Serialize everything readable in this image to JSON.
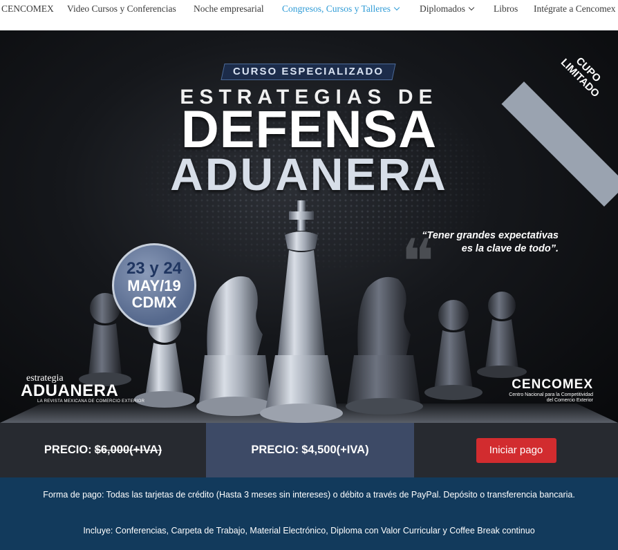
{
  "nav": {
    "items": [
      {
        "label": "CENCOMEX",
        "dropdown": false,
        "active": false
      },
      {
        "label": "Video Cursos y Conferencias",
        "dropdown": false,
        "active": false
      },
      {
        "label": "Noche empresarial",
        "dropdown": false,
        "active": false
      },
      {
        "label": "Congresos, Cursos y Talleres",
        "dropdown": true,
        "active": true
      },
      {
        "label": "Diplomados",
        "dropdown": true,
        "active": false
      },
      {
        "label": "Libros",
        "dropdown": false,
        "active": false
      },
      {
        "label": "Intégrate a Cencomex",
        "dropdown": false,
        "active": false
      }
    ],
    "active_color": "#2e9bd6"
  },
  "banner": {
    "kicker": "CURSO ESPECIALIZADO",
    "title_line1": "ESTRATEGIAS DE",
    "title_line2": "DEFENSA",
    "title_line3": "ADUANERA",
    "ribbon_line1": "CUPO",
    "ribbon_line2": "LIMITADO",
    "quote_line1": "“Tener grandes expectativas",
    "quote_line2": "es la clave de todo”.",
    "date_line1": "23 y 24",
    "date_line2": "MAY/19",
    "date_line3": "CDMX",
    "brand_left_top": "estrategia",
    "brand_left_main": "ADUANERA",
    "brand_left_sub": "LA REVISTA MEXICANA DE COMERCIO EXTERIOR",
    "brand_right_main": "CENCOMEX",
    "brand_right_sub1": "Centro Nacional para la Competitividad",
    "brand_right_sub2": "del Comercio Exterior"
  },
  "pricing": {
    "old_label": "PRECIO:",
    "old_price": "$6,000(+IVA)",
    "new_label": "PRECIO:",
    "new_price": "$4,500(+IVA)",
    "pay_button": "Iniciar pago",
    "button_color": "#d22c2f"
  },
  "info": {
    "payment": "Forma de pago: Todas las tarjetas de crédito (Hasta 3 meses sin intereses) o débito a través de PayPal. Depósito o transferencia bancaria.",
    "includes": "Incluye: Conferencias, Carpeta de Trabajo, Material Electrónico, Diploma con Valor Curricular y Coffee Break continuo",
    "background": "#123a5c"
  }
}
